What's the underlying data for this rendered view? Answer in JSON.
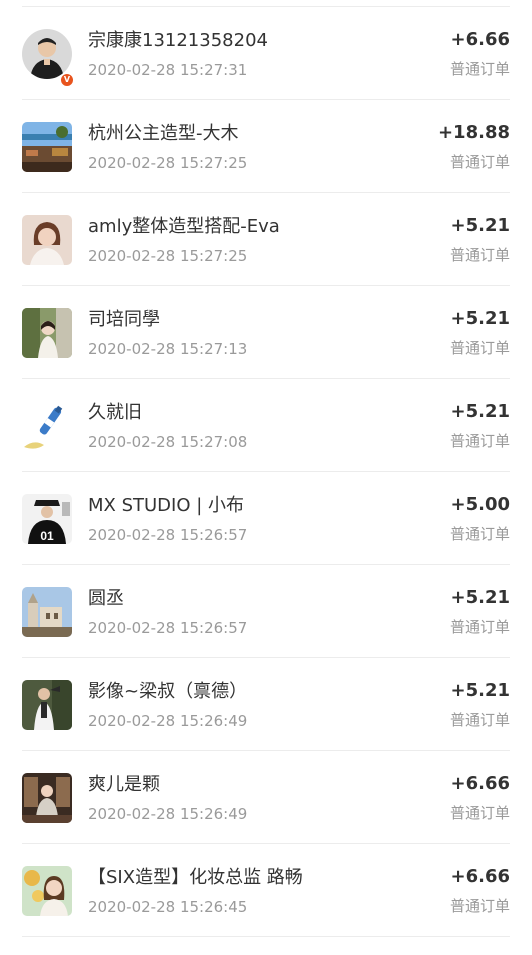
{
  "orders": [
    {
      "name": "宗康康13121358204",
      "time": "2020-02-28 15:27:31",
      "amount": "+6.66",
      "type": "普通订单",
      "verified_badge": "V",
      "avatar": "user-photo-man-in-black"
    },
    {
      "name": "杭州公主造型-大木",
      "time": "2020-02-28 15:27:25",
      "amount": "+18.88",
      "type": "普通订单",
      "avatar": "seaside-photo"
    },
    {
      "name": "amly整体造型搭配-Eva",
      "time": "2020-02-28 15:27:25",
      "amount": "+5.21",
      "type": "普通订单",
      "avatar": "woman-portrait"
    },
    {
      "name": "司培同學 ",
      "time": "2020-02-28 15:27:13",
      "amount": "+5.21",
      "type": "普通订单",
      "avatar": "woman-among-plants"
    },
    {
      "name": "久就旧",
      "time": "2020-02-28 15:27:08",
      "amount": "+5.21",
      "type": "普通订单",
      "avatar": "bottle-photo"
    },
    {
      "name": "MX STUDIO | 小布",
      "time": "2020-02-28 15:26:57",
      "amount": "+5.00",
      "type": "普通订单",
      "avatar": "jersey-01-photo"
    },
    {
      "name": "圆丞",
      "time": "2020-02-28 15:26:57",
      "amount": "+5.21",
      "type": "普通订单",
      "avatar": "castle-photo"
    },
    {
      "name": "影像~梁叔（禀德）",
      "time": "2020-02-28 15:26:49",
      "amount": "+5.21",
      "type": "普通订单",
      "avatar": "man-white-shirt-photo"
    },
    {
      "name": "爽儿是颗",
      "time": "2020-02-28 15:26:49",
      "amount": "+6.66",
      "type": "普通订单",
      "avatar": "woman-sitting-photo"
    },
    {
      "name": "【SIX造型】化妆总监 路畅",
      "time": "2020-02-28 15:26:45",
      "amount": "+6.66",
      "type": "普通订单",
      "avatar": "woman-with-flowers-photo"
    }
  ]
}
